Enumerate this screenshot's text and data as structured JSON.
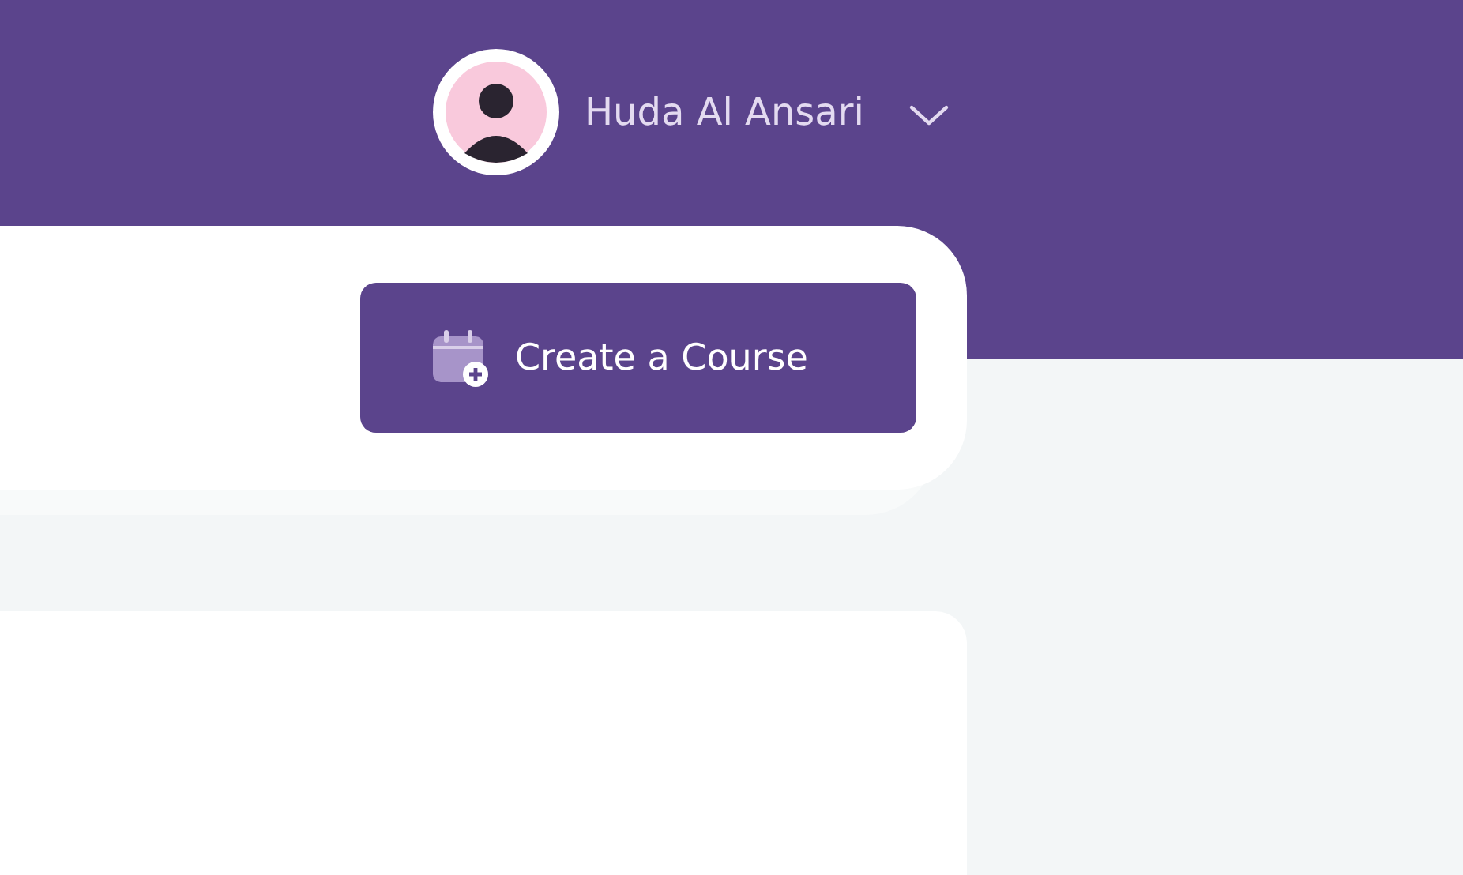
{
  "header": {
    "user_name": "Huda Al Ansari"
  },
  "toolbar": {
    "create_button": "Create a Course"
  }
}
